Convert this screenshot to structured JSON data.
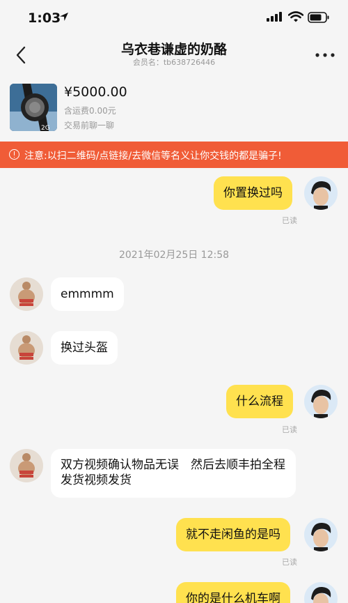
{
  "status_bar": {
    "time": "1:03"
  },
  "nav": {
    "title": "乌衣巷谦虚的奶酪",
    "member": "会员名：tb638726446"
  },
  "product": {
    "price": "¥5000.00",
    "shipping": "含运费0.00元",
    "prechat": "交易前聊一聊"
  },
  "warning": {
    "text": "注意:以扫二维码/点链接/去微信等名义让你交钱的都是骗子!"
  },
  "chat": {
    "read_label": "已读",
    "timestamp": "2021年02月25日 12:58",
    "messages": [
      {
        "from": "me",
        "text": "你置换过吗"
      },
      {
        "from": "other",
        "text": "emmmm"
      },
      {
        "from": "other",
        "text": "换过头盔"
      },
      {
        "from": "me",
        "text": "什么流程"
      },
      {
        "from": "other",
        "text": "双方视频确认物品无误　然后去顺丰拍全程发货视频发货"
      },
      {
        "from": "me",
        "text": "就不走闲鱼的是吗"
      },
      {
        "from": "me",
        "text": "你的是什么机车啊"
      }
    ]
  },
  "colors": {
    "accent_yellow": "#ffe14f",
    "warning_bg": "#f05c37"
  }
}
